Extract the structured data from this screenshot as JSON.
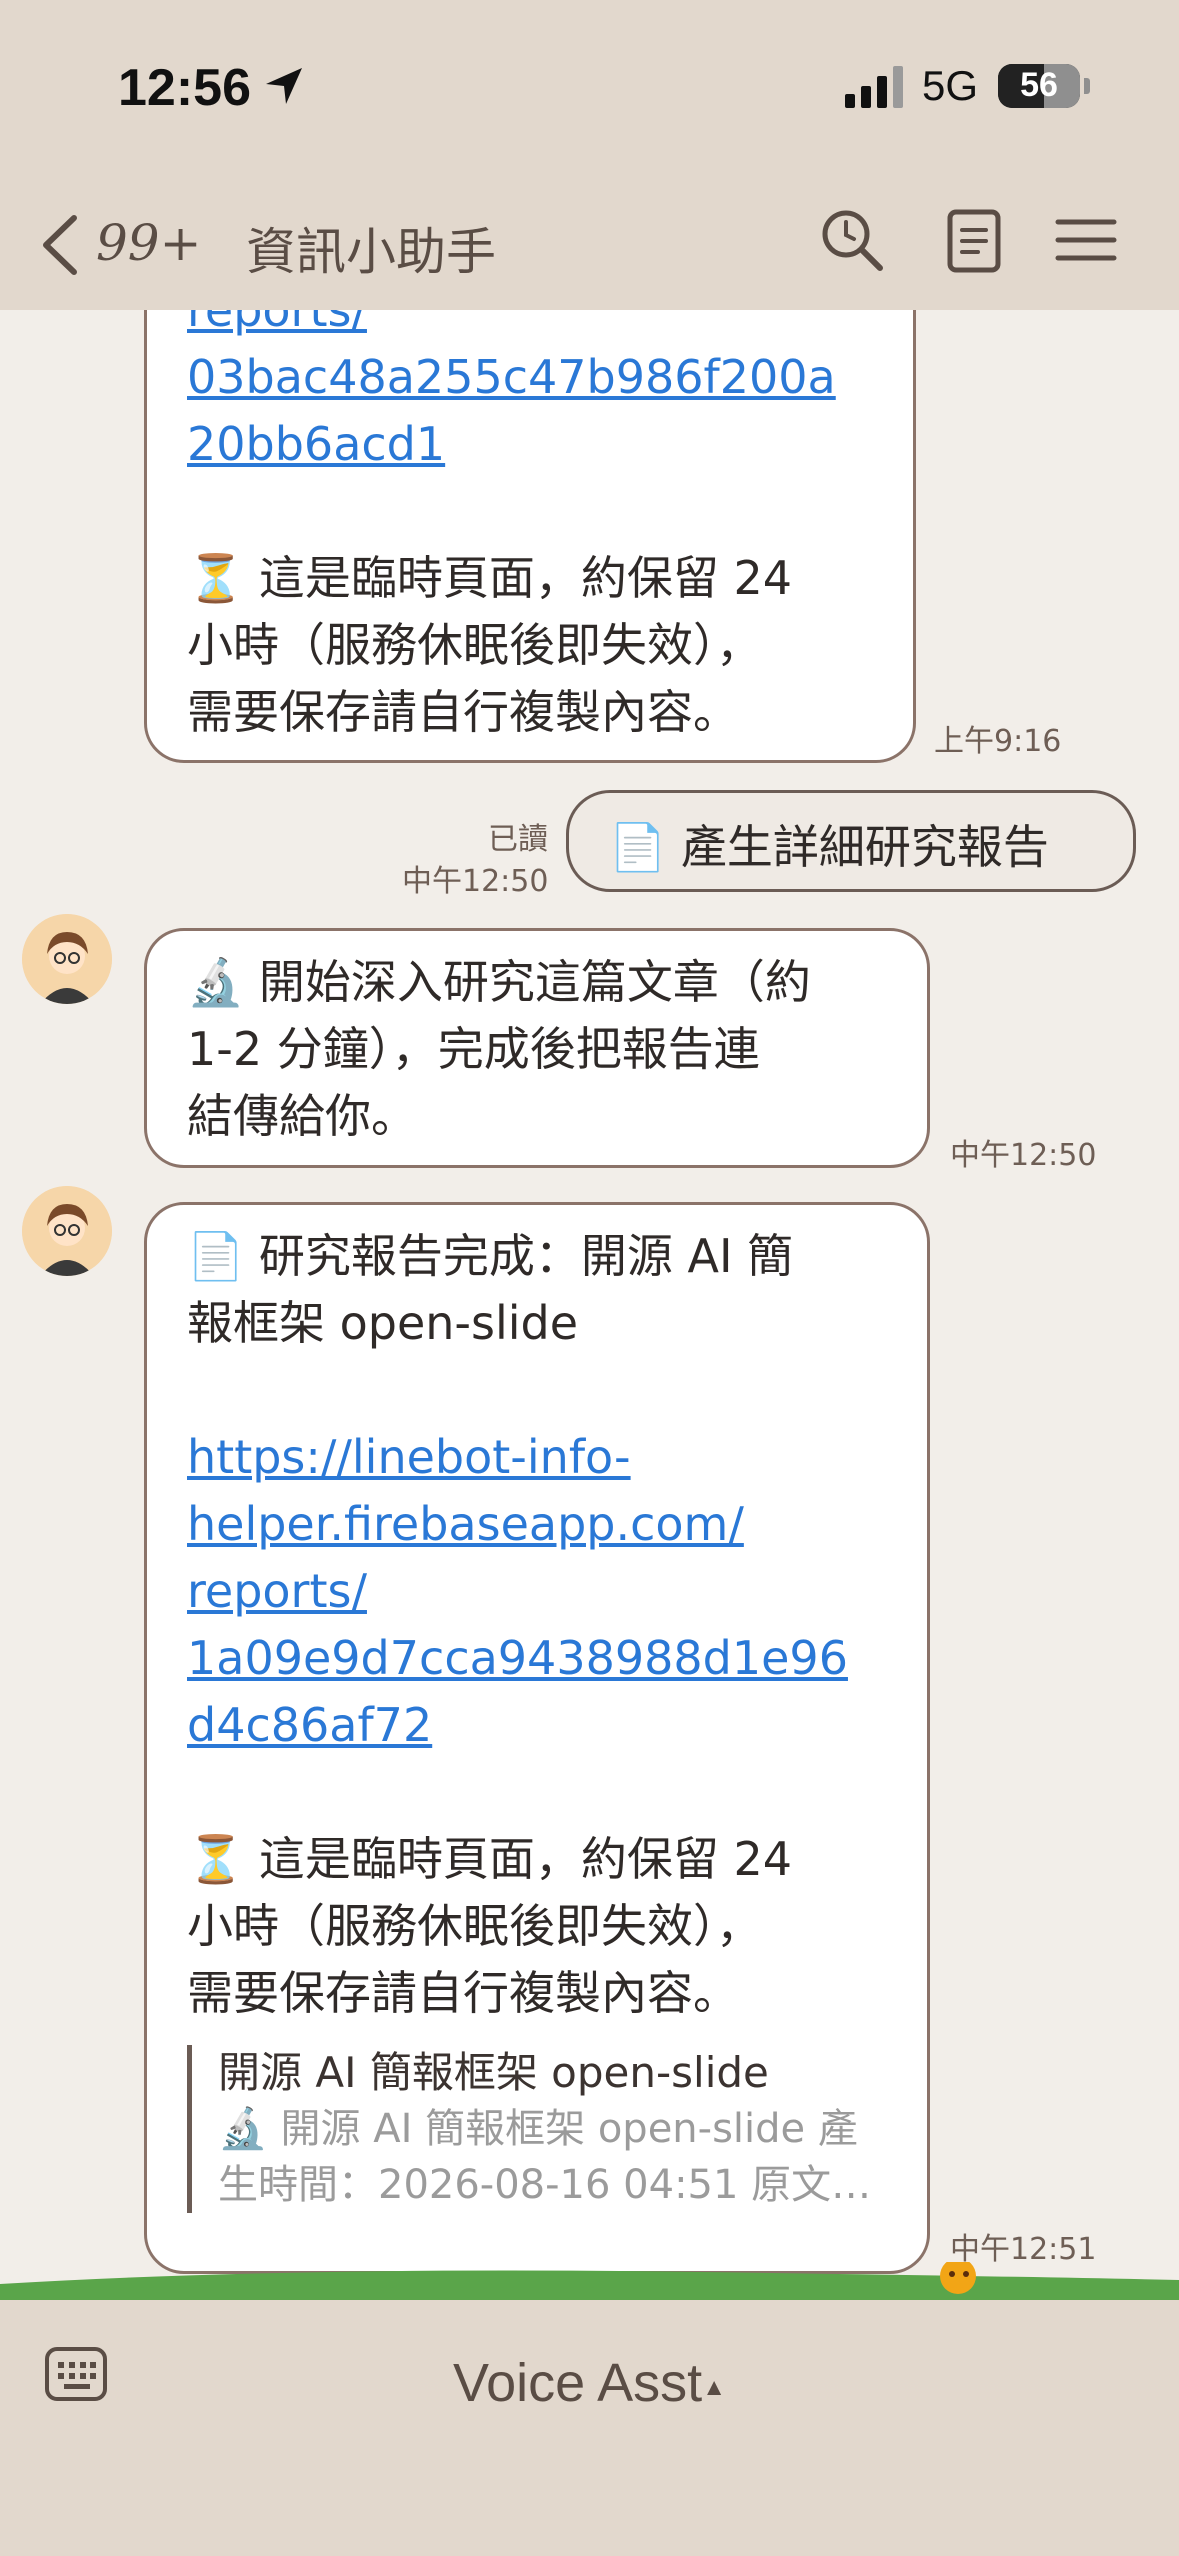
{
  "status": {
    "time": "12:56",
    "network": "5G",
    "battery": "56",
    "battery_level": 0.56
  },
  "header": {
    "back_label": "99+",
    "title": "資訊小助手"
  },
  "messages": {
    "m1": {
      "link_line1": "reports/",
      "link_line2": "03bac48a255c47b986f200a",
      "link_line3": "20bb6acd1",
      "note_icon": "⏳",
      "note_l1": "這是臨時頁面，約保留 24",
      "note_l2": "小時（服務休眠後即失效），",
      "note_l3": "需要保存請自行複製內容。",
      "time": "上午9:16"
    },
    "m2": {
      "read": "已讀",
      "time": "中午12:50",
      "icon": "📄",
      "text": "產生詳細研究報告"
    },
    "m3": {
      "icon": "🔬",
      "l1": "開始深入研究這篇文章（約",
      "l2": "1-2 分鐘），完成後把報告連",
      "l3": "結傳給你。",
      "time": "中午12:50"
    },
    "m4": {
      "icon": "📄",
      "l1": "研究報告完成：開源 AI 簡",
      "l2": "報框架 open-slide",
      "link_l1": "https://linebot-info-",
      "link_l2": "helper.firebaseapp.com/",
      "link_l3": "reports/",
      "link_l4": "1a09e9d7cca9438988d1e96",
      "link_l5": "d4c86af72",
      "note_icon": "⏳",
      "note_l1": "這是臨時頁面，約保留 24",
      "note_l2": "小時（服務休眠後即失效），",
      "note_l3": "需要保存請自行複製內容。",
      "preview_title": "開源 AI 簡報框架 open-slide",
      "preview_icon": "🔬",
      "preview_l1": "開源 AI 簡報框架 open-slide 產",
      "preview_l2": "生時間：2026-08-16 04:51 原文…",
      "time": "中午12:51"
    }
  },
  "footer": {
    "voice_label": "Voice Asst",
    "voice_caret": "▲"
  }
}
